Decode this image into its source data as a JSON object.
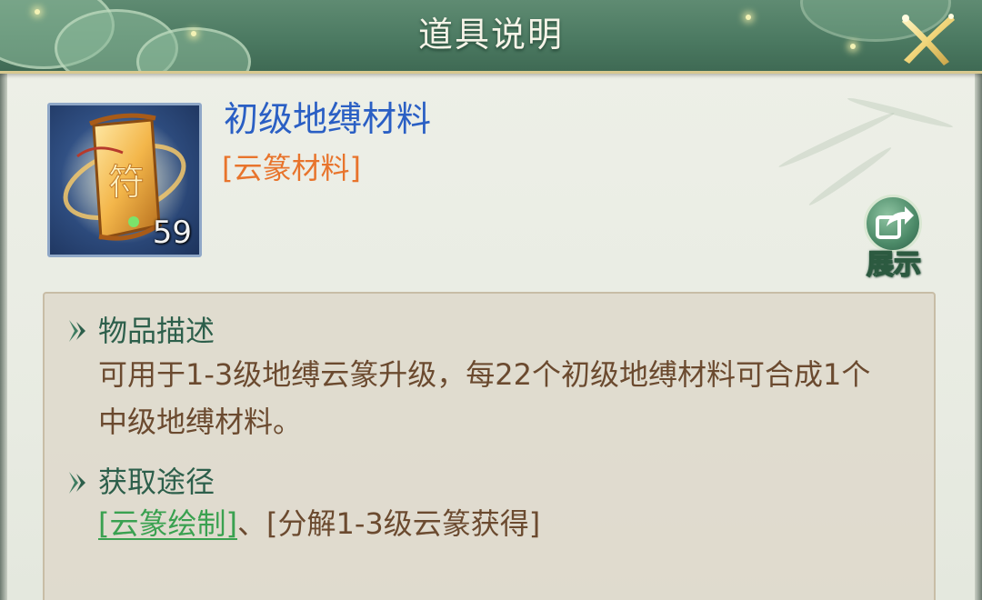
{
  "header": {
    "title": "道具说明"
  },
  "item": {
    "name": "初级地缚材料",
    "category": "[云篆材料]",
    "count": "59",
    "icon": "talisman-scroll-icon"
  },
  "share": {
    "label": "展示",
    "icon": "share-arrow-icon"
  },
  "sections": {
    "description": {
      "title": "物品描述",
      "text": "可用于1-3级地缚云篆升级，每22个初级地缚材料可合成1个中级地缚材料。"
    },
    "source": {
      "title": "获取途径",
      "link": "[云篆绘制]",
      "separator": "、",
      "plain": "[分解1-3级云篆获得]"
    }
  },
  "colors": {
    "item_name": "#2a5fc4",
    "category": "#e8742c",
    "link": "#3aa150",
    "body_text": "#6b4a2f",
    "section_title": "#2d5f4b"
  }
}
